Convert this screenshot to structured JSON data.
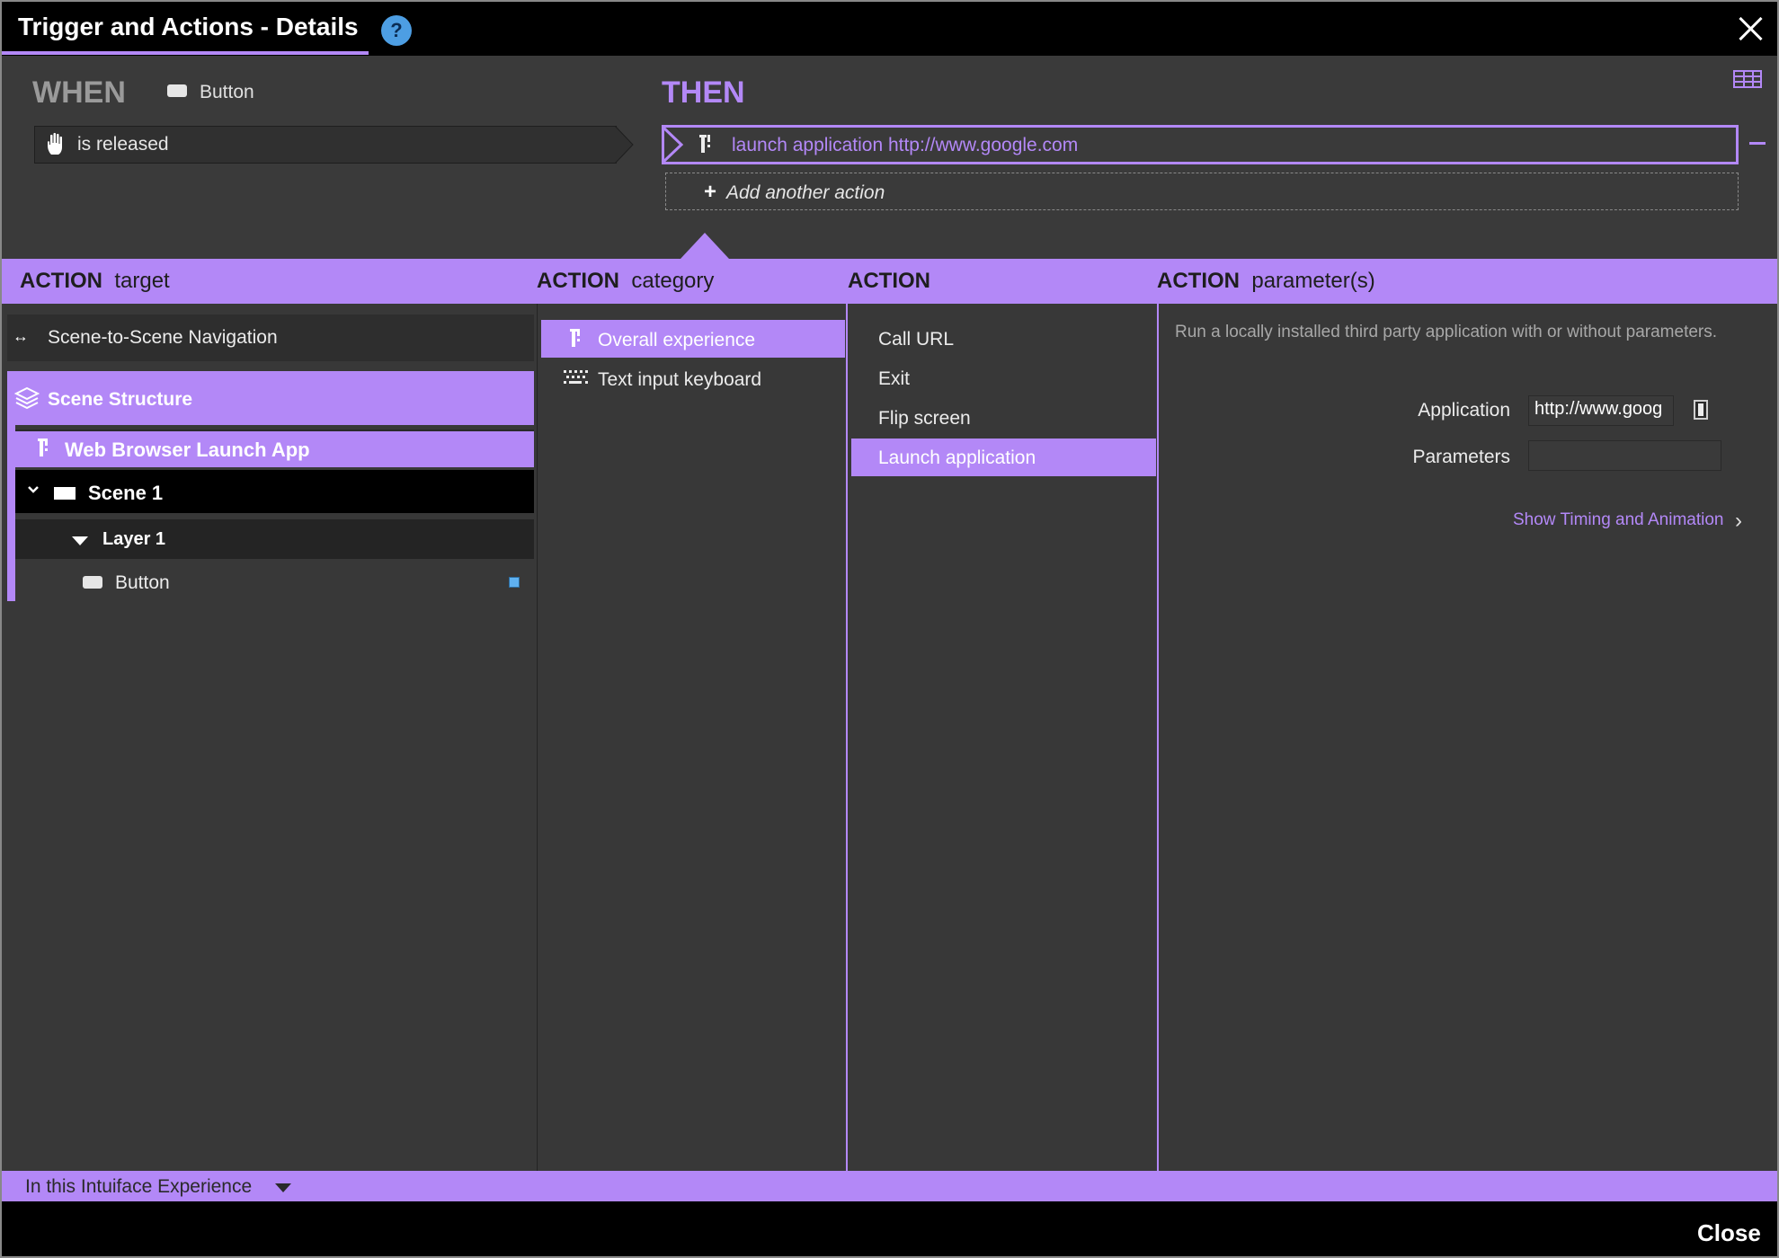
{
  "window": {
    "title": "Trigger and Actions - Details",
    "help_icon": "?"
  },
  "when": {
    "title": "WHEN",
    "object_icon": "button-icon",
    "object": "Button",
    "trigger_icon": "hand-icon",
    "trigger": "is released"
  },
  "then": {
    "title": "THEN",
    "layout_icon": "grid-icon",
    "actions": [
      {
        "icon": "app-launch-icon",
        "label": "launch application http://www.google.com"
      }
    ],
    "add_label": "Add another action"
  },
  "headers": {
    "target": {
      "bold": "ACTION",
      "rest": "target"
    },
    "category": {
      "bold": "ACTION",
      "rest": "category"
    },
    "action": {
      "bold": "ACTION",
      "rest": ""
    },
    "params": {
      "bold": "ACTION",
      "rest": "parameter(s)"
    }
  },
  "targets": {
    "nav_icon": "↔",
    "navigation": "Scene-to-Scene Navigation",
    "scene_structure": "Scene Structure",
    "web_browser": "Web Browser Launch App",
    "scene": "Scene 1",
    "layer": "Layer 1",
    "button": "Button"
  },
  "categories": [
    {
      "icon": "app-launch-icon",
      "label": "Overall experience",
      "selected": true
    },
    {
      "icon": "keyboard-icon",
      "label": "Text input keyboard",
      "selected": false
    }
  ],
  "actions_list": [
    {
      "label": "Call URL",
      "selected": false
    },
    {
      "label": "Exit",
      "selected": false
    },
    {
      "label": "Flip screen",
      "selected": false
    },
    {
      "label": "Launch application",
      "selected": true
    }
  ],
  "params": {
    "description": "Run a locally installed third party application with or without parameters.",
    "application_label": "Application",
    "application_value": "http://www.goog",
    "parameters_label": "Parameters",
    "parameters_value": "",
    "timing_link": "Show Timing and Animation",
    "timing_chevron": "›"
  },
  "footer": {
    "scope": "In this Intuiface Experience",
    "close": "Close"
  },
  "colors": {
    "accent": "#b388f7",
    "background": "#3a3a3a",
    "titlebar": "#000000",
    "status_dot": "#5fb1f1"
  }
}
